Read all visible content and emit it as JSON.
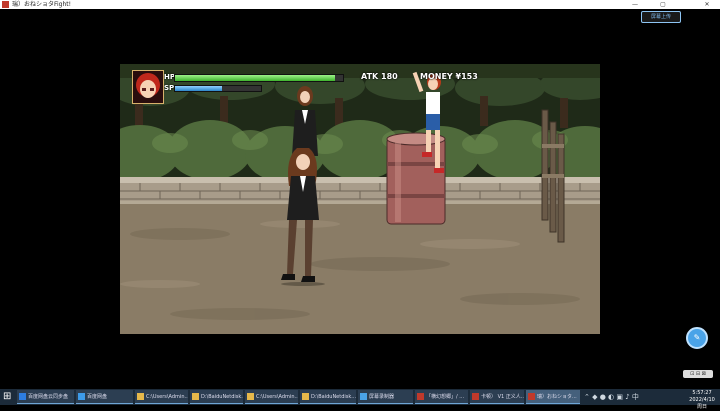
{
  "window": {
    "title": "瑞）おねショタFight!",
    "minimize": "—",
    "maximize": "▢",
    "close": "✕"
  },
  "cloud_button": {
    "label": "屏幕上传"
  },
  "hud": {
    "hp_label": "HP",
    "sp_label": "SP",
    "hp_level": 0.95,
    "sp_level": 0.55,
    "atk": "ATK 180",
    "money": "MONEY ¥153"
  },
  "sprites": [
    {
      "name": "enemy-woman-back",
      "color": "#1e1e1e"
    },
    {
      "name": "enemy-woman-front",
      "color": "#1e1e1e"
    },
    {
      "name": "player-boy",
      "color": "#2a5ea8"
    }
  ],
  "side_button": {
    "label": "✎"
  },
  "mini_tools": {
    "label": "⊡ ⊟ ⊠"
  },
  "taskbar": {
    "start_icon": "windows-icon",
    "items": [
      {
        "label": "百度网盘云同步盘",
        "icon_color": "#2d7de0"
      },
      {
        "label": "百度网盘",
        "icon_color": "#3d9be9"
      },
      {
        "label": "C:\\Users\\Admin...",
        "icon_color": "#e6b84a"
      },
      {
        "label": "D:\\BaiduNetdisk...",
        "icon_color": "#e6b84a"
      },
      {
        "label": "C:\\Users\\Admin...",
        "icon_color": "#e6b84a"
      },
      {
        "label": "D:\\BaiduNetdisk...",
        "icon_color": "#e6b84a"
      },
      {
        "label": "屏幕录制器",
        "icon_color": "#4aa3e8"
      },
      {
        "label": "「横幻想郷」/ ...",
        "icon_color": "#c0392b"
      },
      {
        "label": "卡顿） V1 正义人...",
        "icon_color": "#c0392b"
      },
      {
        "label": "瑞）おねショタ...",
        "icon_color": "#c0392b",
        "active": true
      }
    ],
    "tray": "⌃ ◆ ● ◐ ▣ ♪ 中",
    "time": "5:57:27",
    "date": "2022/4/10 周日"
  }
}
